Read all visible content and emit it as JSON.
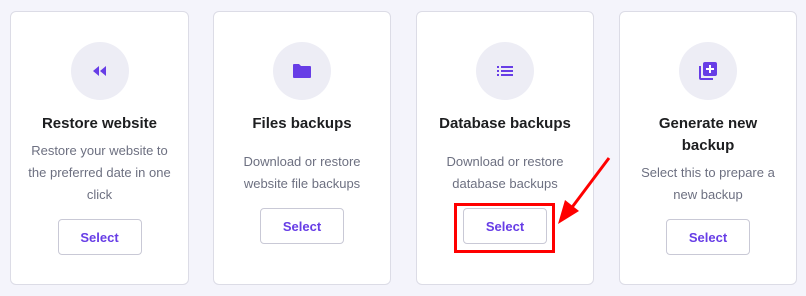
{
  "cards": [
    {
      "icon": "rewind-icon",
      "title": "Restore website",
      "desc": [
        "Restore your website to",
        "the preferred date in one",
        "click"
      ],
      "button": "Select"
    },
    {
      "icon": "folder-icon",
      "title": "Files backups",
      "desc": [
        "Download or restore",
        "website file backups"
      ],
      "button": "Select"
    },
    {
      "icon": "list-icon",
      "title": "Database backups",
      "desc": [
        "Download or restore",
        "database backups"
      ],
      "button": "Select"
    },
    {
      "icon": "add-backup-icon",
      "title": [
        "Generate new",
        "backup"
      ],
      "desc": [
        "Select this to prepare a",
        "new backup"
      ],
      "button": "Select"
    }
  ],
  "colors": {
    "accent": "#673de6",
    "annotation": "#ff0000",
    "background": "#f4f4fb",
    "icon_circle": "#ededf5"
  }
}
